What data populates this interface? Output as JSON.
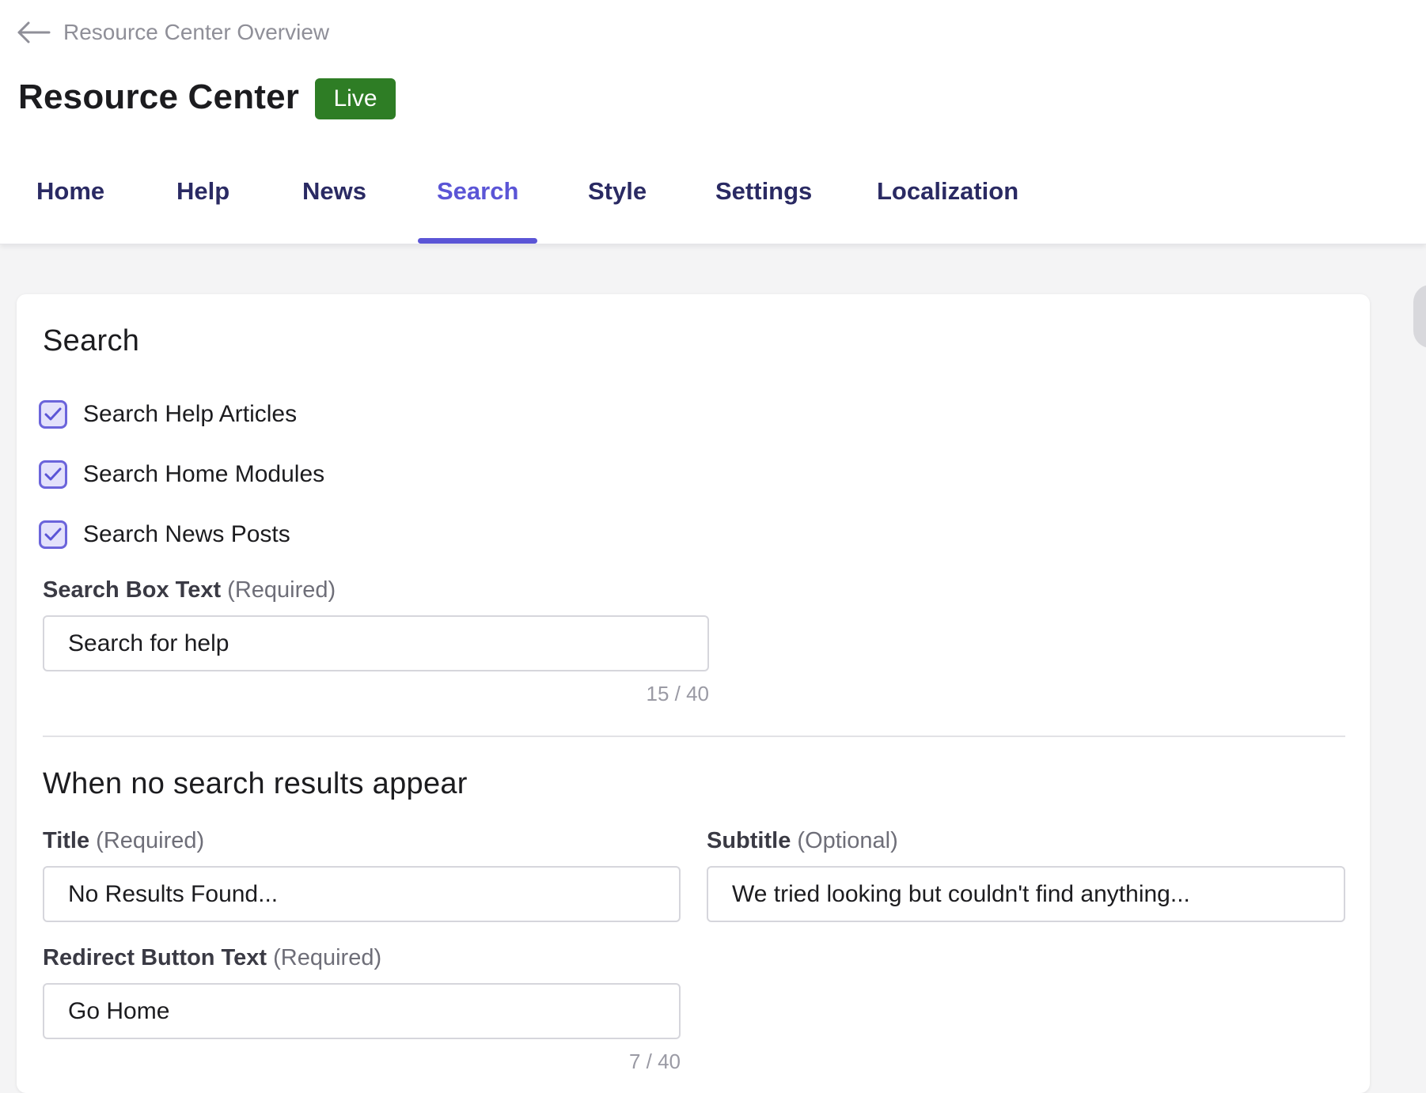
{
  "header": {
    "back_label": "Resource Center Overview",
    "title": "Resource Center",
    "status_badge": "Live",
    "status_color": "#2e7d25"
  },
  "tabs": [
    {
      "label": "Home",
      "active": false
    },
    {
      "label": "Help",
      "active": false
    },
    {
      "label": "News",
      "active": false
    },
    {
      "label": "Search",
      "active": true
    },
    {
      "label": "Style",
      "active": false
    },
    {
      "label": "Settings",
      "active": false
    },
    {
      "label": "Localization",
      "active": false
    }
  ],
  "accent_color": "#5b55d6",
  "search_section": {
    "title": "Search",
    "options": [
      {
        "label": "Search Help Articles",
        "checked": true
      },
      {
        "label": "Search Home Modules",
        "checked": true
      },
      {
        "label": "Search News Posts",
        "checked": true
      }
    ],
    "search_box": {
      "label": "Search Box Text",
      "hint": "(Required)",
      "value": "Search for help",
      "counter": "15 / 40"
    }
  },
  "no_results_section": {
    "title": "When no search results appear",
    "title_field": {
      "label": "Title",
      "hint": "(Required)",
      "value": "No Results Found..."
    },
    "subtitle_field": {
      "label": "Subtitle",
      "hint": "(Optional)",
      "value": "We tried looking but couldn't find anything..."
    },
    "redirect_field": {
      "label": "Redirect Button Text",
      "hint": "(Required)",
      "value": "Go Home",
      "counter": "7 / 40"
    }
  }
}
